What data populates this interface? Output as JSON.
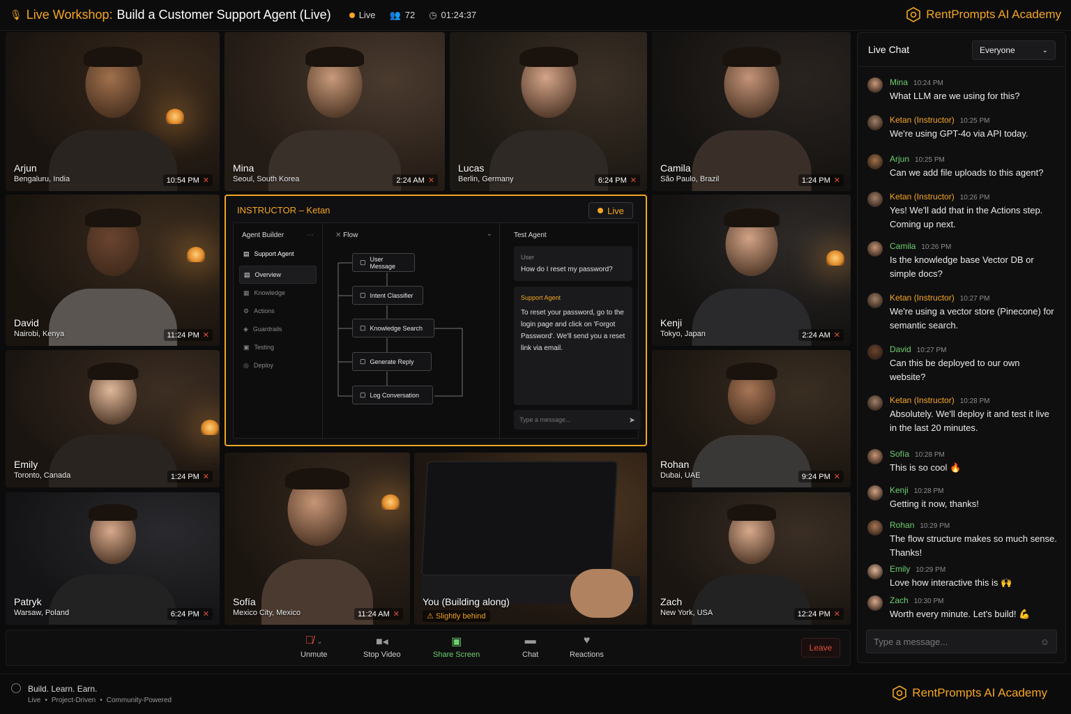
{
  "header": {
    "title_prefix": "Live Workshop:",
    "title_rest": "Build a Customer Support Agent (Live)",
    "status": "Live",
    "participants": "72",
    "timer": "01:24:37",
    "brand": "RentPrompts AI Academy"
  },
  "tiles": [
    {
      "name": "Arjun",
      "location": "Bengaluru, India",
      "time": "10:54 PM"
    },
    {
      "name": "Mina",
      "location": "Seoul, South Korea",
      "time": "2:24 AM"
    },
    {
      "name": "Lucas",
      "location": "Berlin, Germany",
      "time": "6:24 PM"
    },
    {
      "name": "Camila",
      "location": "São Paulo, Brazil",
      "time": "1:24 PM"
    },
    {
      "name": "David",
      "location": "Nairobi, Kenya",
      "time": "11:24 PM"
    },
    {
      "name": "Kenji",
      "location": "Tokyo, Japan",
      "time": "2:24 AM"
    },
    {
      "name": "Emily",
      "location": "Toronto, Canada",
      "time": "1:24 PM"
    },
    {
      "name": "Rohan",
      "location": "Dubai, UAE",
      "time": "9:24 PM"
    },
    {
      "name": "Patryk",
      "location": "Warsaw, Poland",
      "time": "6:24 PM"
    },
    {
      "name": "Sofía",
      "location": "Mexico City, Mexico",
      "time": "11:24 AM"
    },
    {
      "name": "You (Building along)",
      "location": "Slightly behind",
      "time": ""
    },
    {
      "name": "Zach",
      "location": "New York, USA",
      "time": "12:24 PM"
    }
  ],
  "instructor": {
    "title": "INSTRUCTOR – Ketan",
    "live": "Live",
    "agent_builder": {
      "heading": "Agent Builder",
      "project": "Support Agent",
      "items": [
        "Overview",
        "Knowledge",
        "Actions",
        "Guardrails",
        "Testing",
        "Deploy"
      ]
    },
    "flow": {
      "heading": "Flow",
      "nodes": [
        "User Message",
        "Intent Classifier",
        "Knowledge Search",
        "Generate Reply",
        "Log Conversation"
      ]
    },
    "test": {
      "heading": "Test Agent",
      "user_label": "User",
      "user_msg": "How do I reset my password?",
      "agent_label": "Support Agent",
      "agent_msg": "To reset your password, go to the login page and click on 'Forgot Password'. We'll send you a reset link via email.",
      "input_placeholder": "Type a message..."
    }
  },
  "controls": {
    "unmute": "Unmute",
    "stop_video": "Stop Video",
    "share_screen": "Share Screen",
    "chat": "Chat",
    "reactions": "Reactions",
    "leave": "Leave"
  },
  "chat": {
    "title": "Live Chat",
    "filter": "Everyone",
    "input_placeholder": "Type a message...",
    "messages": [
      {
        "author": "Mina",
        "time": "10:24 PM",
        "text": "What LLM are we using for this?"
      },
      {
        "author": "Ketan (Instructor)",
        "time": "10:25 PM",
        "text": "We're using GPT-4o via API today."
      },
      {
        "author": "Arjun",
        "time": "10:25 PM",
        "text": "Can we add file uploads to this agent?"
      },
      {
        "author": "Ketan (Instructor)",
        "time": "10:26 PM",
        "text": "Yes! We'll add that in the Actions step. Coming up next."
      },
      {
        "author": "Camila",
        "time": "10:26 PM",
        "text": "Is the knowledge base Vector DB or simple docs?"
      },
      {
        "author": "Ketan (Instructor)",
        "time": "10:27 PM",
        "text": "We're using a vector store (Pinecone) for semantic search."
      },
      {
        "author": "David",
        "time": "10:27 PM",
        "text": "Can this be deployed to our own website?"
      },
      {
        "author": "Ketan (Instructor)",
        "time": "10:28 PM",
        "text": "Absolutely. We'll deploy it and test it live in the last 20 minutes."
      },
      {
        "author": "Sofía",
        "time": "10:28 PM",
        "text": "This is so cool 🔥"
      },
      {
        "author": "Kenji",
        "time": "10:28 PM",
        "text": "Getting it now, thanks!"
      },
      {
        "author": "Rohan",
        "time": "10:29 PM",
        "text": "The flow structure makes so much sense. Thanks!"
      },
      {
        "author": "Emily",
        "time": "10:29 PM",
        "text": "Love how interactive this is 🙌"
      },
      {
        "author": "Zach",
        "time": "10:30 PM",
        "text": "Worth every minute. Let's build! 💪"
      }
    ]
  },
  "footer": {
    "tagline": "Build. Learn. Earn.",
    "sub1": "Live",
    "sub2": "Project-Driven",
    "sub3": "Community-Powered",
    "brand": "RentPrompts AI Academy"
  }
}
